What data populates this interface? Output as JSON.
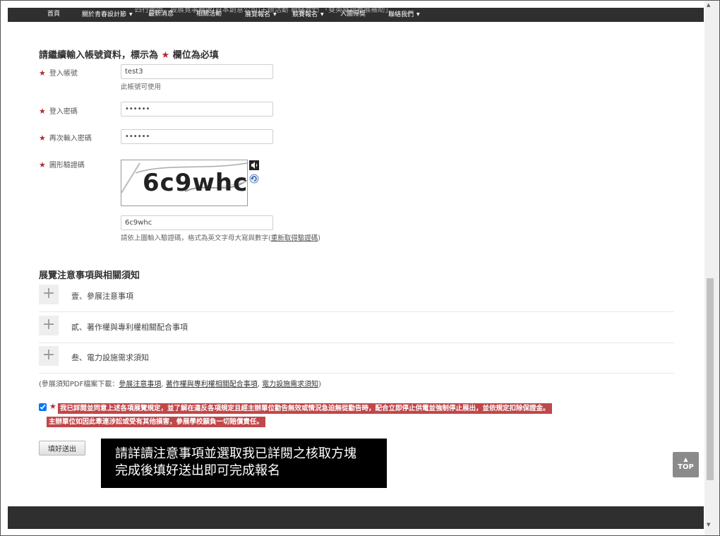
{
  "nav": {
    "ghost_text": "四行國際，設展覽事務處(日本創意公司)主辦活動 聯絡我們 「雙英雙語參展補助」",
    "items": [
      {
        "label": "首頁",
        "has_caret": false
      },
      {
        "label": "關於青春設計節",
        "has_caret": true
      },
      {
        "label": "最新消息",
        "has_caret": false
      },
      {
        "label": "相關活動",
        "has_caret": false
      },
      {
        "label": "展覽報名",
        "has_caret": true
      },
      {
        "label": "競賽報名",
        "has_caret": true
      },
      {
        "label": "入圍得獎",
        "has_caret": false
      },
      {
        "label": "聯絡我們",
        "has_caret": true
      }
    ]
  },
  "account": {
    "heading_pre": "請繼續輸入帳號資料，標示為",
    "heading_star": "★",
    "heading_post": "欄位為必填",
    "username": {
      "label": "登入帳號",
      "value": "test3",
      "help": "此帳號可使用"
    },
    "password": {
      "label": "登入密碼",
      "value": "••••••"
    },
    "password_confirm": {
      "label": "再次輸入密碼",
      "value": "••••••"
    },
    "captcha": {
      "label": "圖形驗證碼",
      "image_text": "6c9whc",
      "value": "6c9whc",
      "help_pre": "請依上圖輸入驗證碼，格式為英文字母大寫與數字(",
      "help_link": "重新取得驗證碼",
      "help_post": ")",
      "audio_icon": "speaker-icon",
      "refresh_icon": "refresh-icon"
    }
  },
  "notices": {
    "heading": "展覽注意事項與相關須知",
    "items": [
      {
        "title": "壹、參展注意事項"
      },
      {
        "title": "貳、著作權與專利權相關配合事項"
      },
      {
        "title": "叁、電力設施需求須知"
      }
    ],
    "pdf_pre": "(參展須知PDF檔案下載：",
    "pdf_links": [
      "參展注意事項",
      "著作權與專利權相關配合事項",
      "電力設施需求須知"
    ],
    "pdf_sep": ", ",
    "pdf_post": ")"
  },
  "agreement": {
    "star": "★",
    "line1": "我已詳閱並同意上述各項展覽規定，並了解在違反各項規定且經主辦單位勸告無效或情況急迫無從勸告時，配合立即停止供電並強制停止展出，並依規定扣除保證金。",
    "line2": "主辦單位如因此牽連涉訟或受有其他損害，參展學校願負一切賠償責任。"
  },
  "submit_label": "填好送出",
  "note": {
    "line1": "請詳讀注意事項並選取我已詳閱之核取方塊",
    "line2": "完成後填好送出即可完成報名"
  },
  "top_button": {
    "label": "TOP",
    "arrow": "▲"
  },
  "scrollbar": {
    "up": "▲",
    "down": "▼"
  },
  "colors": {
    "accent_red": "#b32d2e",
    "agree_bg": "#c0474a",
    "nav_bg": "#2f2f2f"
  }
}
